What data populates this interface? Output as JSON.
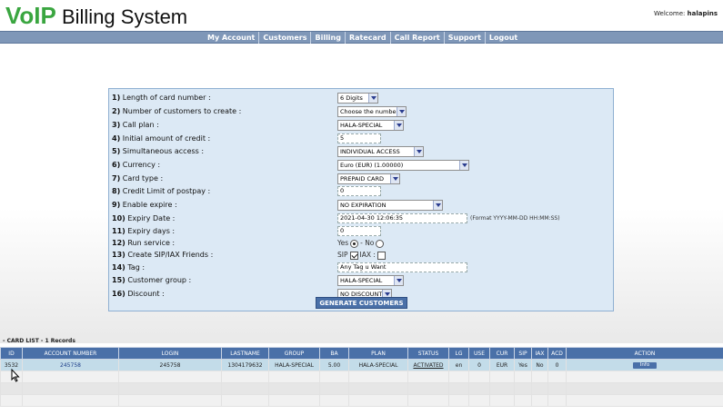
{
  "header": {
    "logo_voip": "VoIP",
    "logo_rest": " Billing System",
    "welcome_prefix": "Welcome: ",
    "welcome_user": "halapins"
  },
  "nav": [
    "My Account",
    "Customers",
    "Billing",
    "Ratecard",
    "Call Report",
    "Support",
    "Logout"
  ],
  "form": {
    "rows": [
      {
        "num": "1)",
        "label": "Length of card number :",
        "value": "6 Digits"
      },
      {
        "num": "2)",
        "label": "Number of customers to create :",
        "value": "Choose the number"
      },
      {
        "num": "3)",
        "label": "Call plan :",
        "value": "HALA-SPECIAL"
      },
      {
        "num": "4)",
        "label": "Initial amount of credit :",
        "value": "5"
      },
      {
        "num": "5)",
        "label": "Simultaneous access :",
        "value": "INDIVIDUAL ACCESS"
      },
      {
        "num": "6)",
        "label": "Currency :",
        "value": "Euro (EUR) (1.00000)"
      },
      {
        "num": "7)",
        "label": "Card type :",
        "value": "PREPAID CARD"
      },
      {
        "num": "8)",
        "label": "Credit Limit of postpay :",
        "value": "0"
      },
      {
        "num": "9)",
        "label": "Enable expire :",
        "value": "NO EXPIRATION"
      },
      {
        "num": "10)",
        "label": "Expiry Date :",
        "value": "2021-04-30 12:06:35",
        "hint": "(Format YYYY-MM-DD HH:MM:SS)"
      },
      {
        "num": "11)",
        "label": "Expiry days :",
        "value": "0"
      },
      {
        "num": "12)",
        "label": "Run service :",
        "yes": "Yes",
        "no": "- No"
      },
      {
        "num": "13)",
        "label": "Create SIP/IAX Friends :",
        "sip": "SIP",
        "iax": "IAX :"
      },
      {
        "num": "14)",
        "label": "Tag :",
        "value": "Any Tag u Want"
      },
      {
        "num": "15)",
        "label": "Customer group :",
        "value": "HALA-SPECIAL"
      },
      {
        "num": "16)",
        "label": "Discount :",
        "value": "NO DISCOUNT"
      }
    ],
    "generate_label": "GENERATE CUSTOMERS"
  },
  "card_list": {
    "title": "- CARD LIST - 1 Records",
    "columns": [
      "ID",
      "ACCOUNT NUMBER",
      "LOGIN",
      "LASTNAME",
      "GROUP",
      "BA",
      "PLAN",
      "STATUS",
      "LG",
      "USE",
      "CUR",
      "SIP",
      "IAX",
      "ACD",
      "ACTION"
    ],
    "rows": [
      {
        "id": "3532",
        "account": "245758",
        "login": "245758",
        "lastname": "1304179632",
        "group": "HALA-SPECIAL",
        "ba": "5.00",
        "plan": "HALA-SPECIAL",
        "status": "ACTIVATED",
        "lg": "en",
        "use": "0",
        "cur": "EUR",
        "sip": "Yes",
        "iax": "No",
        "acd": "0",
        "action": "Info"
      }
    ]
  },
  "colors": {
    "brand_green": "#3aa640",
    "nav_bar": "#7f97b8",
    "panel_bg": "#dce9f5",
    "table_header": "#4a70a8",
    "selected_row": "#c3dce9"
  }
}
